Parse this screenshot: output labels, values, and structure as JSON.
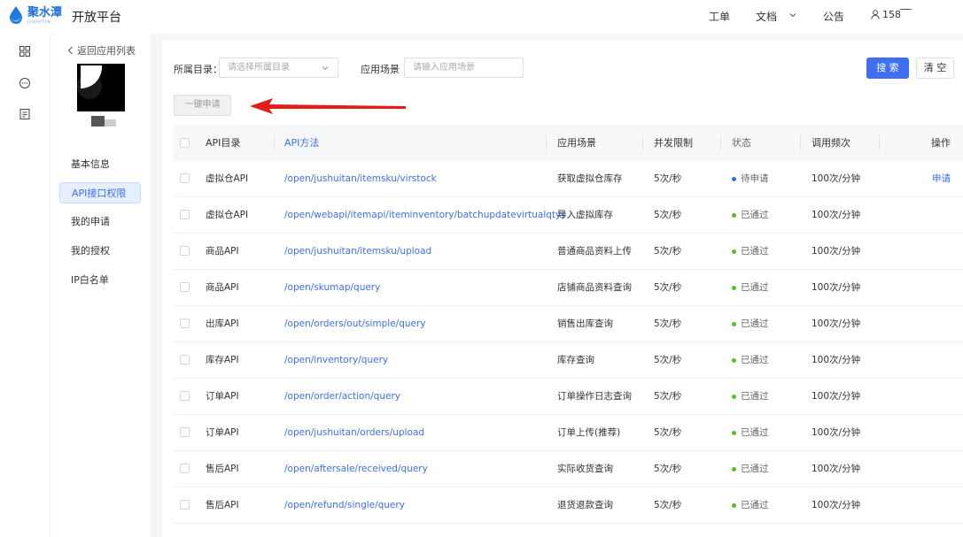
{
  "colors": {
    "accent": "#3f6ef0",
    "link": "#3b6ef5",
    "pending": "#2d6df6",
    "passed": "#52c41a",
    "arrow": "#e21b1b"
  },
  "header": {
    "logo_cn": "聚水潭",
    "logo_en": "JUSHUITAN",
    "title": "开放平台",
    "nav_ticket": "工单",
    "nav_docs": "文档",
    "nav_notice": "公告",
    "user": "158 ͞ ͞"
  },
  "rail": {
    "icons": [
      "apps-grid-icon",
      "chat-icon",
      "document-icon"
    ]
  },
  "sidebar": {
    "back": "返回应用列表",
    "items": [
      {
        "label": "基本信息",
        "active": false
      },
      {
        "label": "API接口权限",
        "active": true
      },
      {
        "label": "我的申请",
        "active": false
      },
      {
        "label": "我的授权",
        "active": false
      },
      {
        "label": "IP白名单",
        "active": false
      }
    ]
  },
  "filters": {
    "catalog_label": "所属目录：",
    "catalog_placeholder": "请选择所属目录",
    "scene_label": "应用场景",
    "scene_placeholder": "请输入应用场景",
    "search": "搜 索",
    "clear": "清 空",
    "apply_all": "一键申请"
  },
  "table": {
    "headers": {
      "category": "API目录",
      "method": "API方法",
      "scene": "应用场景",
      "limit": "并发限制",
      "status": "状态",
      "frequency": "调用频次",
      "operation": "操作"
    },
    "rows": [
      {
        "category": "虚拟仓API",
        "method": "/open/jushuitan/itemsku/virstock",
        "scene": "获取虚拟仓库存",
        "limit": "5次/秒",
        "status": "待申请",
        "status_type": "pending",
        "frequency": "100次/分钟",
        "operation": "申请"
      },
      {
        "category": "虚拟仓API",
        "method": "/open/webapi/itemapi/iteminventory/batchupdatevirtualqtys",
        "scene": "导入虚拟库存",
        "limit": "5次/秒",
        "status": "已通过",
        "status_type": "passed",
        "frequency": "100次/分钟",
        "operation": ""
      },
      {
        "category": "商品API",
        "method": "/open/jushuitan/itemsku/upload",
        "scene": "普通商品资料上传",
        "limit": "5次/秒",
        "status": "已通过",
        "status_type": "passed",
        "frequency": "100次/分钟",
        "operation": ""
      },
      {
        "category": "商品API",
        "method": "/open/skumap/query",
        "scene": "店铺商品资料查询",
        "limit": "5次/秒",
        "status": "已通过",
        "status_type": "passed",
        "frequency": "100次/分钟",
        "operation": ""
      },
      {
        "category": "出库API",
        "method": "/open/orders/out/simple/query",
        "scene": "销售出库查询",
        "limit": "5次/秒",
        "status": "已通过",
        "status_type": "passed",
        "frequency": "100次/分钟",
        "operation": ""
      },
      {
        "category": "库存API",
        "method": "/open/inventory/query",
        "scene": "库存查询",
        "limit": "5次/秒",
        "status": "已通过",
        "status_type": "passed",
        "frequency": "100次/分钟",
        "operation": ""
      },
      {
        "category": "订单API",
        "method": "/open/order/action/query",
        "scene": "订单操作日志查询",
        "limit": "5次/秒",
        "status": "已通过",
        "status_type": "passed",
        "frequency": "100次/分钟",
        "operation": ""
      },
      {
        "category": "订单API",
        "method": "/open/jushuitan/orders/upload",
        "scene": "订单上传(推荐)",
        "limit": "5次/秒",
        "status": "已通过",
        "status_type": "passed",
        "frequency": "100次/分钟",
        "operation": ""
      },
      {
        "category": "售后API",
        "method": "/open/aftersale/received/query",
        "scene": "实际收货查询",
        "limit": "5次/秒",
        "status": "已通过",
        "status_type": "passed",
        "frequency": "100次/分钟",
        "operation": ""
      },
      {
        "category": "售后API",
        "method": "/open/refund/single/query",
        "scene": "退货退款查询",
        "limit": "5次/秒",
        "status": "已通过",
        "status_type": "passed",
        "frequency": "100次/分钟",
        "operation": ""
      }
    ]
  }
}
